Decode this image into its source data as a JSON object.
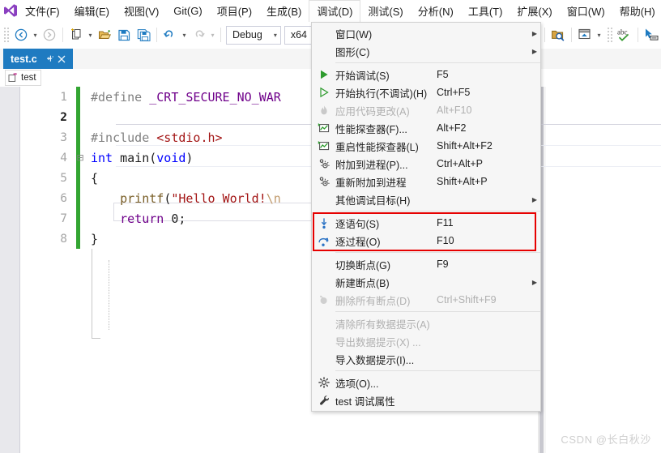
{
  "app": {
    "logo_icon": "visual-studio-logo"
  },
  "menubar": {
    "items": [
      {
        "label": "文件(F)",
        "active": false
      },
      {
        "label": "编辑(E)",
        "active": false
      },
      {
        "label": "视图(V)",
        "active": false
      },
      {
        "label": "Git(G)",
        "active": false
      },
      {
        "label": "项目(P)",
        "active": false
      },
      {
        "label": "生成(B)",
        "active": false
      },
      {
        "label": "调试(D)",
        "active": true
      },
      {
        "label": "测试(S)",
        "active": false
      },
      {
        "label": "分析(N)",
        "active": false
      },
      {
        "label": "工具(T)",
        "active": false
      },
      {
        "label": "扩展(X)",
        "active": false
      },
      {
        "label": "窗口(W)",
        "active": false
      },
      {
        "label": "帮助(H)",
        "active": false
      }
    ]
  },
  "toolbar": {
    "nav_back_icon": "navigate-back-icon",
    "nav_forward_icon": "navigate-forward-icon",
    "new_item_icon": "new-item-icon",
    "open_file_icon": "open-file-icon",
    "save_icon": "save-icon",
    "save_all_icon": "save-all-icon",
    "undo_icon": "undo-icon",
    "redo_icon": "redo-icon",
    "config_value": "Debug",
    "platform_value": "x64",
    "find_in_files_icon": "find-in-files-icon",
    "window_layout_icon": "window-layout-icon",
    "spellcheck_icon": "abc-spellcheck-icon",
    "pointer_icon": "pointer-select-icon"
  },
  "tab": {
    "title": "test.c",
    "pin_icon": "pin-icon",
    "close_icon": "close-icon"
  },
  "breadcrumb": {
    "project_icon": "project-add-icon",
    "project": "test"
  },
  "editor": {
    "lines": [
      {
        "num": "1",
        "fold": "",
        "current": false,
        "tokens": [
          {
            "t": "#define ",
            "c": "k-pre"
          },
          {
            "t": "_CRT_SECURE_NO_WAR",
            "c": "k-mac"
          }
        ]
      },
      {
        "num": "2",
        "fold": "",
        "current": true,
        "tokens": []
      },
      {
        "num": "3",
        "fold": "",
        "current": false,
        "tokens": [
          {
            "t": "#include ",
            "c": "k-pre"
          },
          {
            "t": "<stdio.h>",
            "c": "k-inc"
          }
        ]
      },
      {
        "num": "4",
        "fold": "⊟",
        "current": false,
        "tokens": [
          {
            "t": "int ",
            "c": "k-kw"
          },
          {
            "t": "main",
            "c": "k-id"
          },
          {
            "t": "(",
            "c": "k-punc"
          },
          {
            "t": "void",
            "c": "k-kw"
          },
          {
            "t": ")",
            "c": "k-punc"
          }
        ]
      },
      {
        "num": "5",
        "fold": "",
        "current": false,
        "tokens": [
          {
            "t": "{",
            "c": "k-punc"
          }
        ]
      },
      {
        "num": "6",
        "fold": "",
        "current": false,
        "tokens": [
          {
            "t": "    ",
            "c": "k-punc"
          },
          {
            "t": "printf",
            "c": "k-fn"
          },
          {
            "t": "(",
            "c": "k-punc"
          },
          {
            "t": "\"Hello World!",
            "c": "k-str"
          },
          {
            "t": "\\n",
            "c": "k-esc"
          }
        ]
      },
      {
        "num": "7",
        "fold": "",
        "current": false,
        "tokens": [
          {
            "t": "    ",
            "c": "k-punc"
          },
          {
            "t": "return ",
            "c": "k-purple"
          },
          {
            "t": "0",
            "c": "k-punc"
          },
          {
            "t": ";",
            "c": "k-punc"
          }
        ]
      },
      {
        "num": "8",
        "fold": "",
        "current": false,
        "tokens": [
          {
            "t": "}",
            "c": "k-punc"
          }
        ]
      }
    ]
  },
  "debug_menu": {
    "highlight_color": "#e60000",
    "items": [
      {
        "kind": "item",
        "label": "窗口(W)",
        "shortcut": "",
        "icon": "",
        "submenu": true,
        "disabled": false
      },
      {
        "kind": "item",
        "label": "图形(C)",
        "shortcut": "",
        "icon": "",
        "submenu": true,
        "disabled": false
      },
      {
        "kind": "sep"
      },
      {
        "kind": "item",
        "label": "开始调试(S)",
        "shortcut": "F5",
        "icon": "start-debug-icon",
        "submenu": false,
        "disabled": false
      },
      {
        "kind": "item",
        "label": "开始执行(不调试)(H)",
        "shortcut": "Ctrl+F5",
        "icon": "start-without-debug-icon",
        "submenu": false,
        "disabled": false
      },
      {
        "kind": "item",
        "label": "应用代码更改(A)",
        "shortcut": "Alt+F10",
        "icon": "apply-code-changes-icon",
        "submenu": false,
        "disabled": true
      },
      {
        "kind": "item",
        "label": "性能探查器(F)...",
        "shortcut": "Alt+F2",
        "icon": "performance-profiler-icon",
        "submenu": false,
        "disabled": false
      },
      {
        "kind": "item",
        "label": "重启性能探查器(L)",
        "shortcut": "Shift+Alt+F2",
        "icon": "restart-profiler-icon",
        "submenu": false,
        "disabled": false
      },
      {
        "kind": "item",
        "label": "附加到进程(P)...",
        "shortcut": "Ctrl+Alt+P",
        "icon": "attach-process-icon",
        "submenu": false,
        "disabled": false
      },
      {
        "kind": "item",
        "label": "重新附加到进程",
        "shortcut": "Shift+Alt+P",
        "icon": "reattach-process-icon",
        "submenu": false,
        "disabled": false
      },
      {
        "kind": "item",
        "label": "其他调试目标(H)",
        "shortcut": "",
        "icon": "",
        "submenu": true,
        "disabled": false
      },
      {
        "kind": "sep"
      },
      {
        "kind": "item",
        "label": "逐语句(S)",
        "shortcut": "F11",
        "icon": "step-into-icon",
        "submenu": false,
        "disabled": false
      },
      {
        "kind": "item",
        "label": "逐过程(O)",
        "shortcut": "F10",
        "icon": "step-over-icon",
        "submenu": false,
        "disabled": false
      },
      {
        "kind": "sep"
      },
      {
        "kind": "item",
        "label": "切换断点(G)",
        "shortcut": "F9",
        "icon": "",
        "submenu": false,
        "disabled": false
      },
      {
        "kind": "item",
        "label": "新建断点(B)",
        "shortcut": "",
        "icon": "",
        "submenu": true,
        "disabled": false
      },
      {
        "kind": "item",
        "label": "删除所有断点(D)",
        "shortcut": "Ctrl+Shift+F9",
        "icon": "delete-all-breakpoints-icon",
        "submenu": false,
        "disabled": true
      },
      {
        "kind": "sep"
      },
      {
        "kind": "item",
        "label": "清除所有数据提示(A)",
        "shortcut": "",
        "icon": "",
        "submenu": false,
        "disabled": true
      },
      {
        "kind": "item",
        "label": "导出数据提示(X) ...",
        "shortcut": "",
        "icon": "",
        "submenu": false,
        "disabled": true
      },
      {
        "kind": "item",
        "label": "导入数据提示(I)...",
        "shortcut": "",
        "icon": "",
        "submenu": false,
        "disabled": false
      },
      {
        "kind": "sep"
      },
      {
        "kind": "item",
        "label": "选项(O)...",
        "shortcut": "",
        "icon": "options-gear-icon",
        "submenu": false,
        "disabled": false
      },
      {
        "kind": "item",
        "label": "test 调试属性",
        "shortcut": "",
        "icon": "wrench-icon",
        "submenu": false,
        "disabled": false
      }
    ]
  },
  "watermark": {
    "text": "CSDN @长白秋沙"
  }
}
